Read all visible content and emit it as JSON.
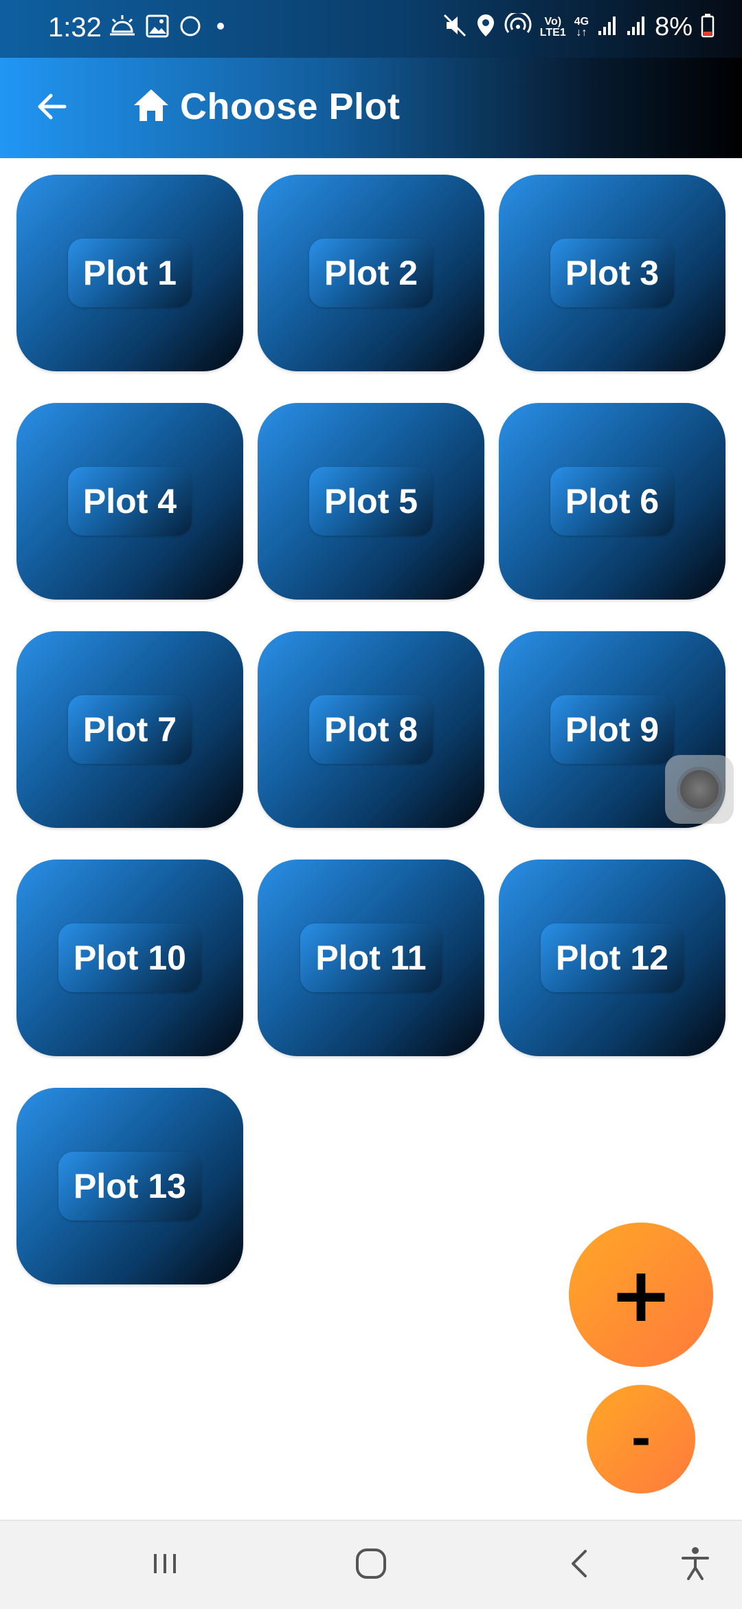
{
  "status_bar": {
    "time": "1:32",
    "battery_percent": "8%",
    "network_top": "Vo)",
    "network_bottom": "LTE1",
    "network_type": "4G",
    "icons": [
      "weather-icon",
      "gallery-icon",
      "circle-icon",
      "dot-icon",
      "mute-icon",
      "location-icon",
      "hotspot-icon",
      "signal-icon",
      "battery-icon"
    ],
    "battery_color": "#e0442f"
  },
  "app_bar": {
    "title": "Choose Plot",
    "back_icon": "arrow-left-icon",
    "title_icon": "home-icon"
  },
  "plots": [
    {
      "label": "Plot 1"
    },
    {
      "label": "Plot 2"
    },
    {
      "label": "Plot 3"
    },
    {
      "label": "Plot 4"
    },
    {
      "label": "Plot 5"
    },
    {
      "label": "Plot 6"
    },
    {
      "label": "Plot 7"
    },
    {
      "label": "Plot 8"
    },
    {
      "label": "Plot 9"
    },
    {
      "label": "Plot 10"
    },
    {
      "label": "Plot 11"
    },
    {
      "label": "Plot 12"
    },
    {
      "label": "Plot 13"
    }
  ],
  "fab": {
    "add_label": "+",
    "remove_label": "-"
  },
  "nav_bar": {
    "icons": [
      "recents-icon",
      "home-icon",
      "back-icon",
      "accessibility-icon"
    ]
  },
  "colors": {
    "app_bar_start": "#2196f3",
    "app_bar_end": "#000000",
    "tile_start": "#2a8fe6",
    "tile_end": "#020a14",
    "fab_start": "#ffa726",
    "fab_end": "#ff7a3d"
  }
}
